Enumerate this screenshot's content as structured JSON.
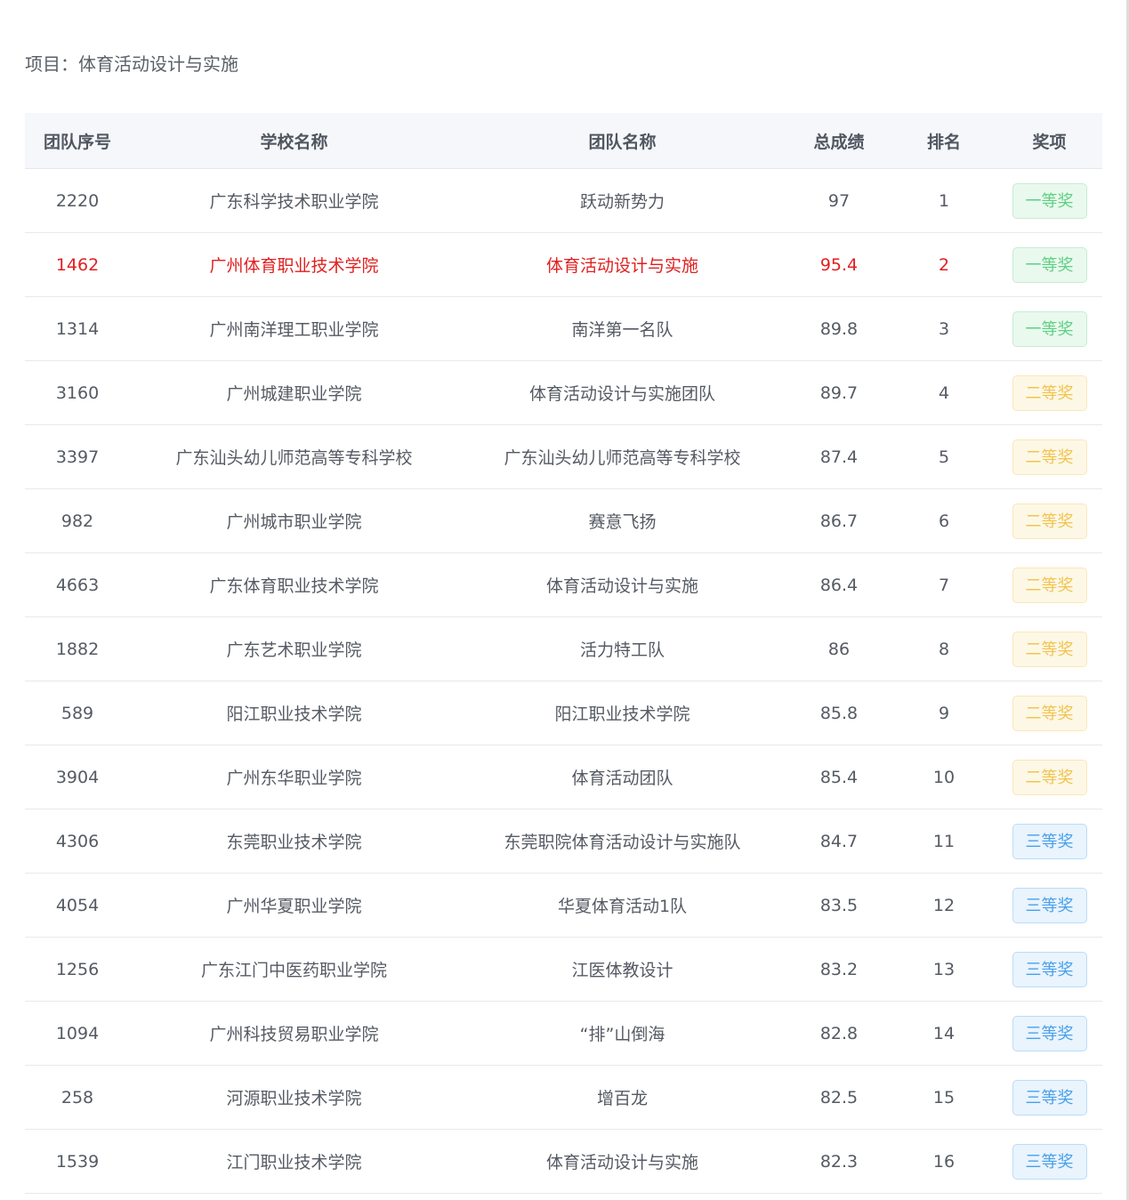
{
  "project": {
    "title": "项目：体育活动设计与实施"
  },
  "table": {
    "columns": {
      "id": "团队序号",
      "school": "学校名称",
      "team": "团队名称",
      "score": "总成绩",
      "rank": "排名",
      "award": "奖项"
    },
    "rows": [
      {
        "id": "2220",
        "school": "广东科学技术职业学院",
        "team": "跃动新势力",
        "score": "97",
        "rank": "1",
        "award": "一等奖",
        "award_level": "first",
        "highlight": false
      },
      {
        "id": "1462",
        "school": "广州体育职业技术学院",
        "team": "体育活动设计与实施",
        "score": "95.4",
        "rank": "2",
        "award": "一等奖",
        "award_level": "first",
        "highlight": true
      },
      {
        "id": "1314",
        "school": "广州南洋理工职业学院",
        "team": "南洋第一名队",
        "score": "89.8",
        "rank": "3",
        "award": "一等奖",
        "award_level": "first",
        "highlight": false
      },
      {
        "id": "3160",
        "school": "广州城建职业学院",
        "team": "体育活动设计与实施团队",
        "score": "89.7",
        "rank": "4",
        "award": "二等奖",
        "award_level": "second",
        "highlight": false
      },
      {
        "id": "3397",
        "school": "广东汕头幼儿师范高等专科学校",
        "team": "广东汕头幼儿师范高等专科学校",
        "score": "87.4",
        "rank": "5",
        "award": "二等奖",
        "award_level": "second",
        "highlight": false
      },
      {
        "id": "982",
        "school": "广州城市职业学院",
        "team": "赛意飞扬",
        "score": "86.7",
        "rank": "6",
        "award": "二等奖",
        "award_level": "second",
        "highlight": false
      },
      {
        "id": "4663",
        "school": "广东体育职业技术学院",
        "team": "体育活动设计与实施",
        "score": "86.4",
        "rank": "7",
        "award": "二等奖",
        "award_level": "second",
        "highlight": false
      },
      {
        "id": "1882",
        "school": "广东艺术职业学院",
        "team": "活力特工队",
        "score": "86",
        "rank": "8",
        "award": "二等奖",
        "award_level": "second",
        "highlight": false
      },
      {
        "id": "589",
        "school": "阳江职业技术学院",
        "team": "阳江职业技术学院",
        "score": "85.8",
        "rank": "9",
        "award": "二等奖",
        "award_level": "second",
        "highlight": false
      },
      {
        "id": "3904",
        "school": "广州东华职业学院",
        "team": "体育活动团队",
        "score": "85.4",
        "rank": "10",
        "award": "二等奖",
        "award_level": "second",
        "highlight": false
      },
      {
        "id": "4306",
        "school": "东莞职业技术学院",
        "team": "东莞职院体育活动设计与实施队",
        "score": "84.7",
        "rank": "11",
        "award": "三等奖",
        "award_level": "third",
        "highlight": false
      },
      {
        "id": "4054",
        "school": "广州华夏职业学院",
        "team": "华夏体育活动1队",
        "score": "83.5",
        "rank": "12",
        "award": "三等奖",
        "award_level": "third",
        "highlight": false
      },
      {
        "id": "1256",
        "school": "广东江门中医药职业学院",
        "team": "江医体教设计",
        "score": "83.2",
        "rank": "13",
        "award": "三等奖",
        "award_level": "third",
        "highlight": false
      },
      {
        "id": "1094",
        "school": "广州科技贸易职业学院",
        "team": "“排”山倒海",
        "score": "82.8",
        "rank": "14",
        "award": "三等奖",
        "award_level": "third",
        "highlight": false
      },
      {
        "id": "258",
        "school": "河源职业技术学院",
        "team": "增百龙",
        "score": "82.5",
        "rank": "15",
        "award": "三等奖",
        "award_level": "third",
        "highlight": false
      },
      {
        "id": "1539",
        "school": "江门职业技术学院",
        "team": "体育活动设计与实施",
        "score": "82.3",
        "rank": "16",
        "award": "三等奖",
        "award_level": "third",
        "highlight": false
      }
    ]
  },
  "colors": {
    "highlight_text": "#e02020",
    "award_first": "#5fcf83",
    "award_second": "#f1c44e",
    "award_third": "#4aa0ea",
    "header_background": "#f5f7fa"
  }
}
